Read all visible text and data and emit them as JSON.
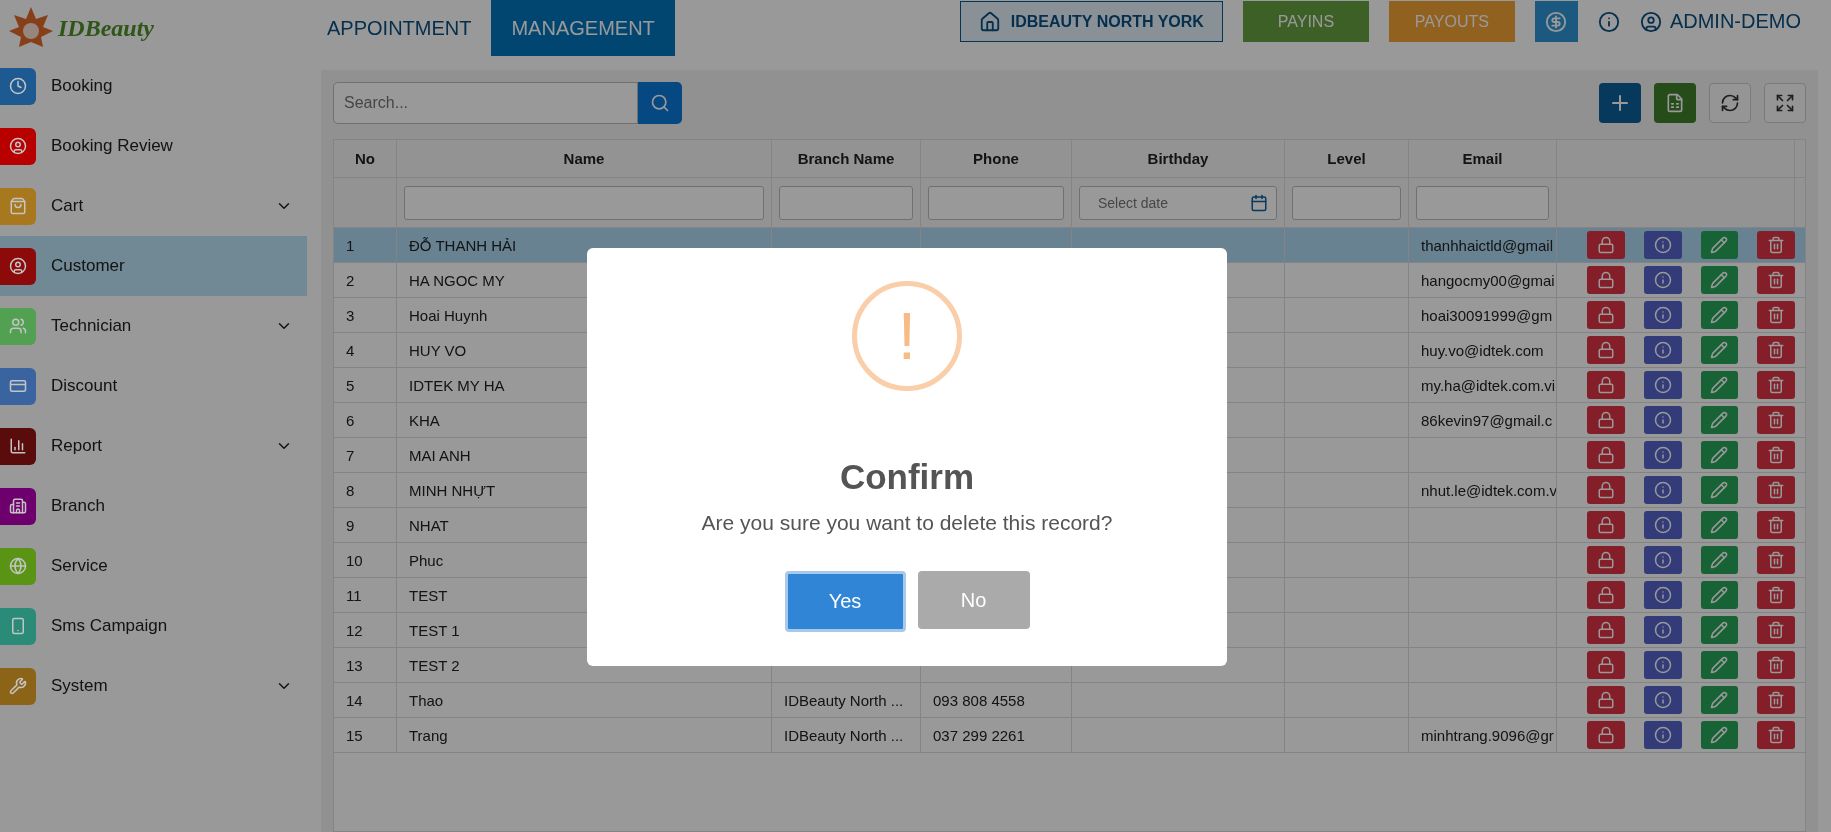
{
  "header": {
    "logo": "IDBeauty",
    "nav": [
      {
        "label": "APPOINTMENT",
        "selected": false
      },
      {
        "label": "MANAGEMENT",
        "selected": true
      }
    ],
    "branch": "IDBEAUTY NORTH YORK",
    "payins": "PAYINS",
    "payouts": "PAYOUTS",
    "user": "ADMIN-DEMO"
  },
  "sidebar": {
    "items": [
      {
        "label": "Booking",
        "color": "#1d5a91",
        "selected": false,
        "expandable": false
      },
      {
        "label": "Booking Review",
        "color": "#b80000",
        "selected": false,
        "expandable": false
      },
      {
        "label": "Cart",
        "color": "#a8781e",
        "selected": false,
        "expandable": true
      },
      {
        "label": "Customer",
        "color": "#8c0a0a",
        "selected": true,
        "expandable": false
      },
      {
        "label": "Technician",
        "color": "#52a052",
        "selected": false,
        "expandable": true
      },
      {
        "label": "Discount",
        "color": "#3a64a0",
        "selected": false,
        "expandable": false
      },
      {
        "label": "Report",
        "color": "#5a0c0c",
        "selected": false,
        "expandable": true
      },
      {
        "label": "Branch",
        "color": "#6e006e",
        "selected": false,
        "expandable": false
      },
      {
        "label": "Service",
        "color": "#5a9414",
        "selected": false,
        "expandable": false
      },
      {
        "label": "Sms Campaign",
        "color": "#2a8c78",
        "selected": false,
        "expandable": false
      },
      {
        "label": "System",
        "color": "#8c6418",
        "selected": false,
        "expandable": true
      }
    ]
  },
  "search": {
    "placeholder": "Search..."
  },
  "table": {
    "columns": [
      {
        "label": "No"
      },
      {
        "label": "Name",
        "kind": "text"
      },
      {
        "label": "Branch Name",
        "kind": "text"
      },
      {
        "label": "Phone",
        "kind": "text"
      },
      {
        "label": "Birthday",
        "kind": "date",
        "placeholder": "Select date"
      },
      {
        "label": "Level",
        "kind": "text"
      },
      {
        "label": "Email",
        "kind": "text"
      }
    ],
    "rows": [
      {
        "no": "1",
        "name": "ĐỖ THANH HẢI",
        "email": "thanhhaictld@gmail",
        "selected": true
      },
      {
        "no": "2",
        "name": "HA NGOC MY",
        "email": "hangocmy00@gmai",
        "selected": false
      },
      {
        "no": "3",
        "name": "Hoai Huynh",
        "email": "hoai30091999@gm",
        "selected": false
      },
      {
        "no": "4",
        "name": "HUY VO",
        "email": "huy.vo@idtek.com",
        "selected": false
      },
      {
        "no": "5",
        "name": "IDTEK MY HA",
        "email": "my.ha@idtek.com.vi",
        "selected": false
      },
      {
        "no": "6",
        "name": "KHA",
        "email": "86kevin97@gmail.c",
        "selected": false
      },
      {
        "no": "7",
        "name": "MAI ANH",
        "selected": false
      },
      {
        "no": "8",
        "name": "MINH NHỰT",
        "email": "nhut.le@idtek.com.v",
        "selected": false
      },
      {
        "no": "9",
        "name": "NHAT",
        "selected": false
      },
      {
        "no": "10",
        "name": "Phuc",
        "selected": false
      },
      {
        "no": "11",
        "name": "TEST",
        "selected": false
      },
      {
        "no": "12",
        "name": "TEST 1",
        "selected": false
      },
      {
        "no": "13",
        "name": "TEST 2",
        "selected": false
      },
      {
        "no": "14",
        "name": "Thao",
        "branch": "IDBeauty North ...",
        "phone": "093 808 4558",
        "selected": false
      },
      {
        "no": "15",
        "name": "Trang",
        "branch": "IDBeauty North ...",
        "phone": "037 299 2261",
        "email": "minhtrang.9096@gr",
        "selected": false
      }
    ]
  },
  "dialog": {
    "icon": "!",
    "title": "Confirm",
    "message": "Are you sure you want to delete this record?",
    "buttons": [
      {
        "label": "Yes",
        "kind": "primary"
      },
      {
        "label": "No",
        "kind": "secondary"
      }
    ]
  }
}
